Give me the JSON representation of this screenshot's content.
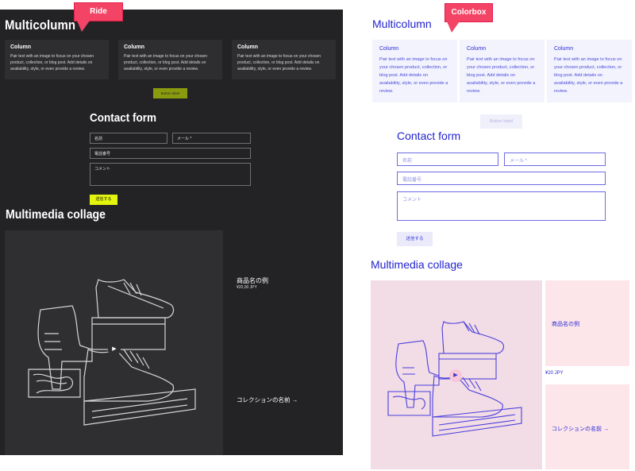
{
  "callouts": {
    "left": "Ride",
    "right": "Colorbox"
  },
  "ride": {
    "multicolumn_title": "Multicolumn",
    "columns": [
      {
        "title": "Column",
        "text": "Pair text with an image to focus on your chosen product, collection, or blog post. Add details on availability, style, or even provide a review."
      },
      {
        "title": "Column",
        "text": "Pair text with an image to focus on your chosen product, collection, or blog post. Add details on availability, style, or even provide a review."
      },
      {
        "title": "Column",
        "text": "Pair text with an image to focus on your chosen product, collection, or blog post. Add details on availability, style, or even provide a review."
      }
    ],
    "button_label": "Button label",
    "contact_title": "Contact form",
    "fields": {
      "name": "名前",
      "email": "メール *",
      "phone": "電話番号",
      "comment": "コメント"
    },
    "send": "送信する",
    "collage_title": "Multimedia collage",
    "product_name": "商品名の例",
    "product_price": "¥20,00 JPY",
    "collection_name": "コレクションの名前 →",
    "colors": {
      "bg": "#232325",
      "accent": "#e3f50c",
      "button": "#8a9b0f"
    }
  },
  "colorbox": {
    "multicolumn_title": "Multicolumn",
    "columns": [
      {
        "title": "Column",
        "text": "Pair text with an image to focus on your chosen product, collection, or blog post. Add details on availability, style, or even provide a review."
      },
      {
        "title": "Column",
        "text": "Pair text with an image to focus on your chosen product, collection, or blog post. Add details on availability, style, or even provide a review."
      },
      {
        "title": "Column",
        "text": "Pair text with an image to focus on your chosen product, collection, or blog post. Add details on availability, style, or even provide a review."
      }
    ],
    "button_label": "Button label",
    "contact_title": "Contact form",
    "fields": {
      "name": "名前",
      "email": "メール *",
      "phone": "電話番号",
      "comment": "コメント"
    },
    "send": "送信する",
    "collage_title": "Multimedia collage",
    "product_name": "商品名の例",
    "product_price": "¥20 JPY",
    "collection_name": "コレクションの名前 →",
    "colors": {
      "text": "#2323d0",
      "collage_bg": "#f2dce6",
      "tile_bg": "#fde6ea"
    }
  },
  "icons": {
    "play": "play-icon",
    "shoes": "shoes-illustration"
  }
}
